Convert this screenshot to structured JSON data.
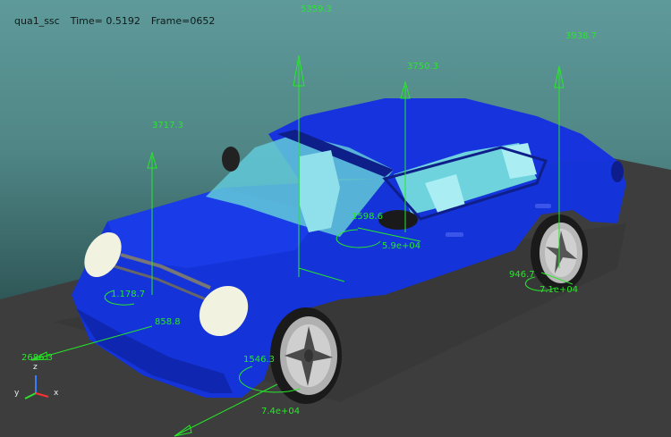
{
  "hud": {
    "name": "qua1_ssc",
    "time": "Time= 0.5192",
    "frame": "Frame=0652"
  },
  "colors": {
    "force_vector": "#27e827",
    "car_body": "#1330d6",
    "ground": "#3c3c3c",
    "glass": "#63c9d8"
  },
  "force_labels": {
    "f1": "5359.3",
    "f2": "3750.3",
    "f3": "3938.7",
    "f4": "3717.3",
    "f5": "1598.6",
    "f6": "5.9e+04",
    "f7": "946.7",
    "f8": "7.1e+04",
    "f9": "1.178.7",
    "f10": "858.8",
    "f11": "2686.3",
    "f12": "1546.3",
    "f13": "7.4e+04"
  },
  "axes": {
    "z": "z",
    "y": "y",
    "x": "x"
  }
}
